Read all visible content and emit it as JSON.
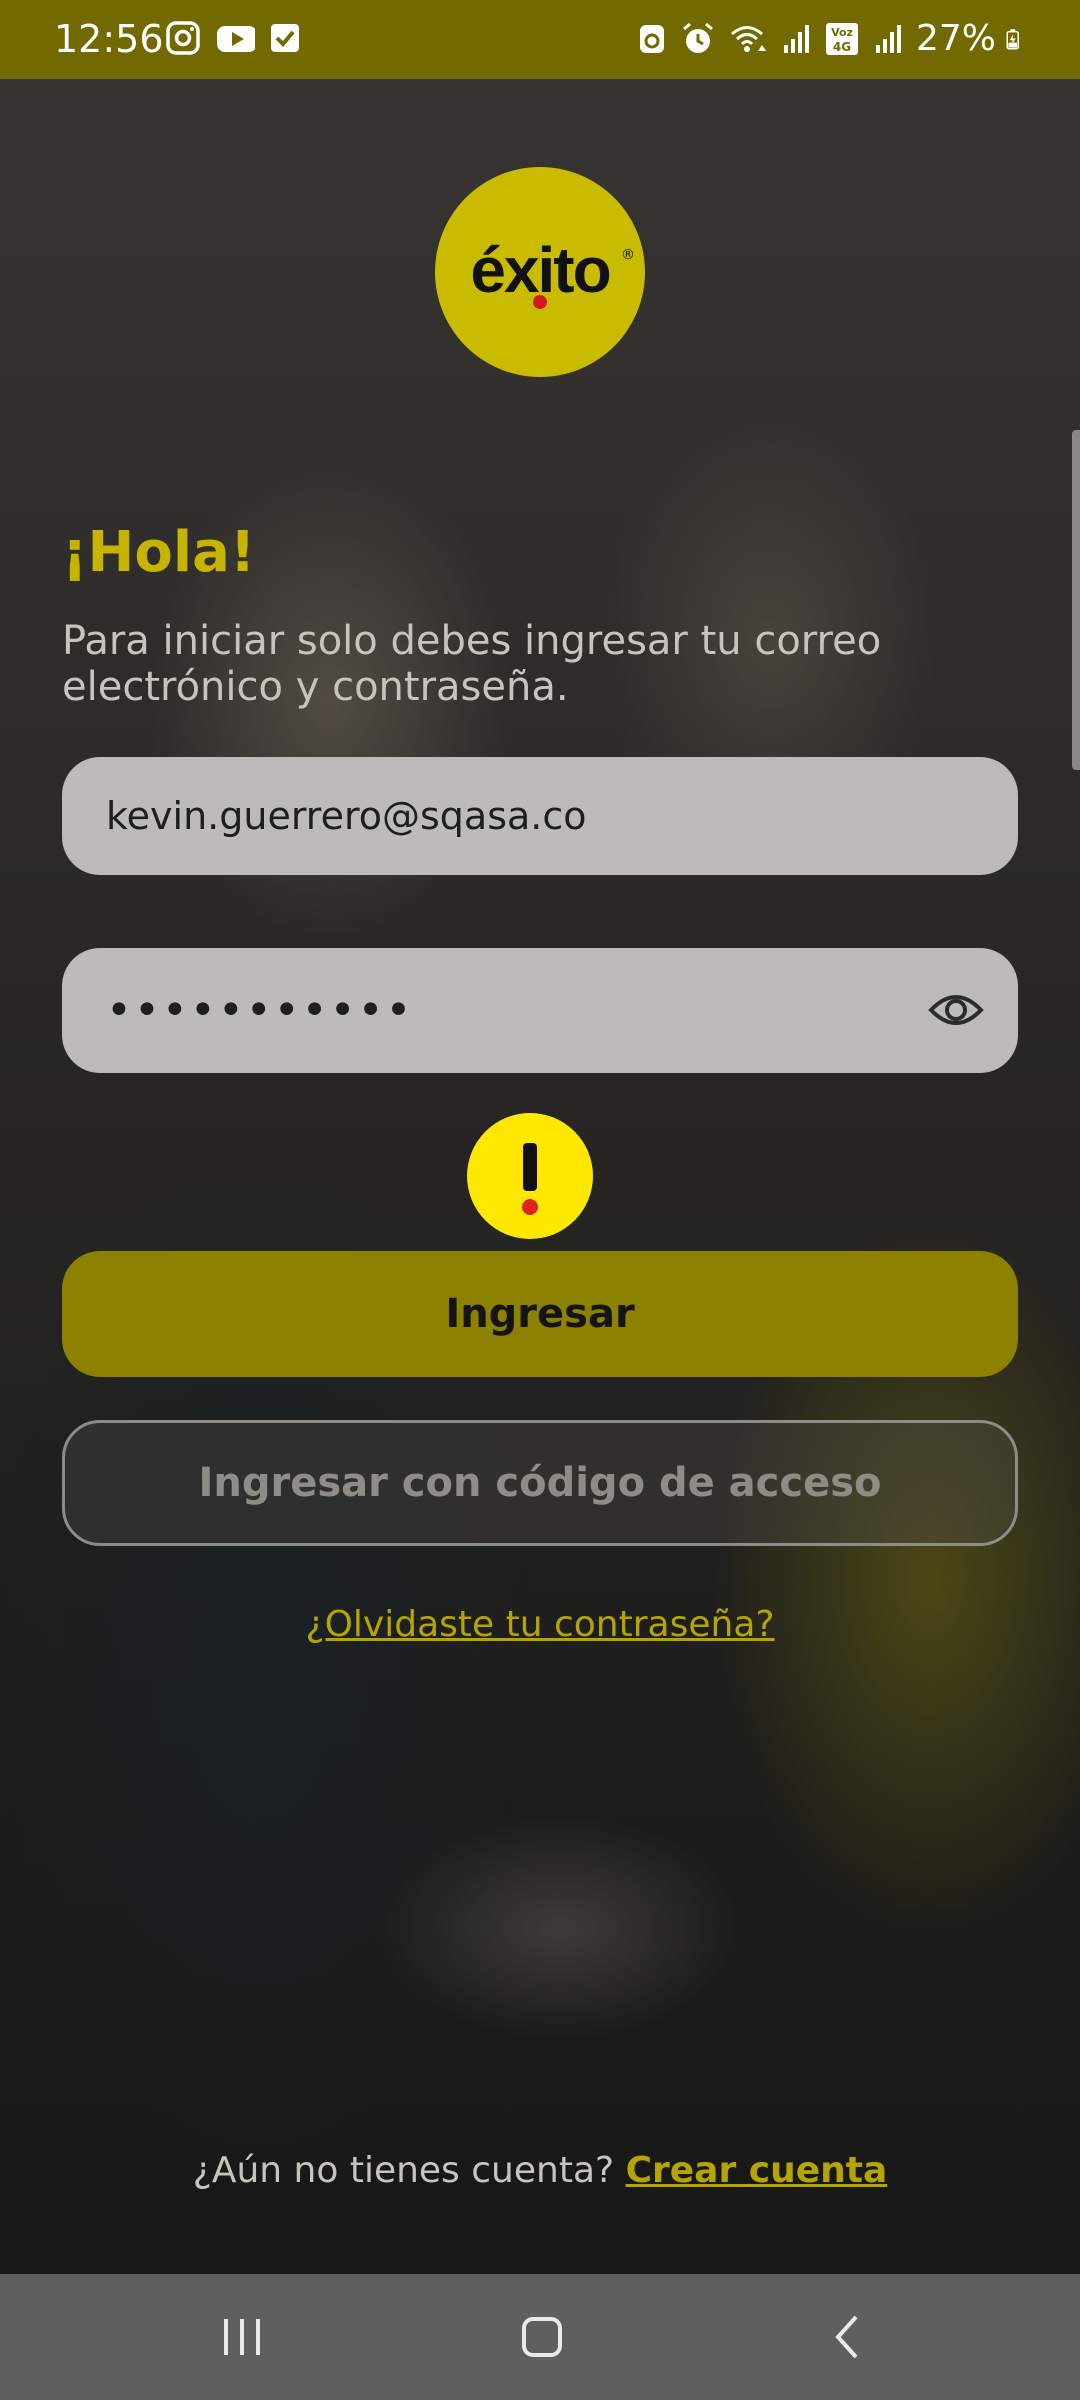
{
  "status_bar": {
    "time": "12:56",
    "battery": "27%",
    "left_icons": [
      "instagram-icon",
      "youtube-icon",
      "tasks-check-icon"
    ],
    "right_icons": [
      "recycle-icon",
      "alarm-icon",
      "wifi-icon",
      "signal-icon",
      "volte-4g-icon",
      "signal-icon",
      "battery-charging-icon"
    ],
    "volte_label": "Vóz 4G"
  },
  "logo": {
    "text": "éxito",
    "registered_mark": "®",
    "color": "#c9bb00"
  },
  "greeting": {
    "title": "¡Hola!",
    "description": "Para iniciar solo debes ingresar tu correo electrónico y contraseña."
  },
  "form": {
    "email_value": "kevin.guerrero@sqasa.co",
    "password_value": "•••••••••••",
    "show_password_icon": "eye-icon"
  },
  "warning": {
    "icon": "exclamation-warning-icon",
    "color": "#ffe800"
  },
  "buttons": {
    "login": "Ingresar",
    "access_code": "Ingresar con código de acceso"
  },
  "links": {
    "forgot_password": "¿Olvidaste tu contraseña?",
    "no_account": "¿Aún no tienes cuenta?",
    "create_account": "Crear cuenta"
  },
  "navigation": {
    "items": [
      "recents-icon",
      "home-icon",
      "back-icon"
    ]
  },
  "colors": {
    "brand": "#c6b400",
    "status_bar": "#726a00",
    "primary_button": "#8c8100",
    "nav_bar": "#5f5f5f"
  }
}
